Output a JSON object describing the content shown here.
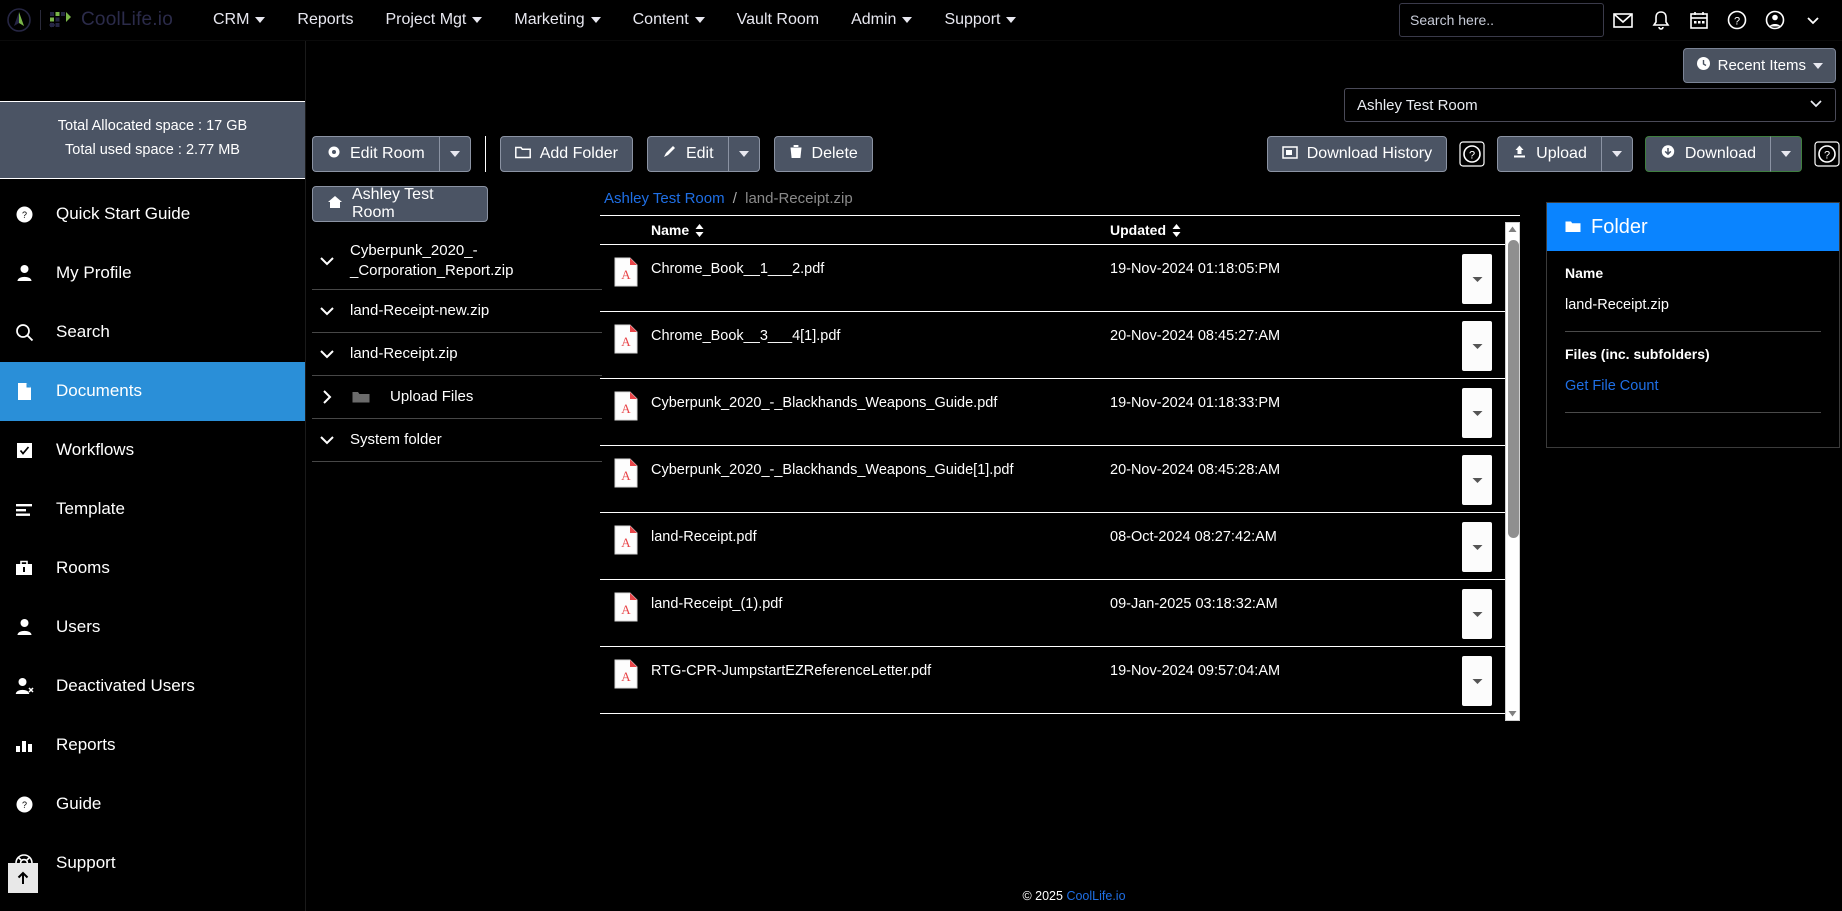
{
  "brand": {
    "name": "CoolLife.io"
  },
  "topnav": {
    "items": [
      {
        "label": "CRM",
        "has_caret": true
      },
      {
        "label": "Reports",
        "has_caret": false
      },
      {
        "label": "Project Mgt",
        "has_caret": true
      },
      {
        "label": "Marketing",
        "has_caret": true
      },
      {
        "label": "Content",
        "has_caret": true
      },
      {
        "label": "Vault Room",
        "has_caret": false
      },
      {
        "label": "Admin",
        "has_caret": true
      },
      {
        "label": "Support",
        "has_caret": true
      }
    ],
    "search_placeholder": "Search here..",
    "icons": [
      "mail-icon",
      "bell-icon",
      "calendar-icon",
      "help-circle-icon",
      "user-account-icon",
      "chevron-down-icon"
    ]
  },
  "page": {
    "title": "Vault Room",
    "recent_items_label": "Recent Items",
    "room_selected": "Ashley Test Room"
  },
  "sidebar": {
    "storage": {
      "allocated": "Total Allocated space : 17 GB",
      "used": "Total used space : 2.77 MB"
    },
    "items": [
      {
        "label": "Quick Start Guide",
        "icon": "question-circle-icon",
        "active": false
      },
      {
        "label": "My Profile",
        "icon": "user-icon",
        "active": false
      },
      {
        "label": "Search",
        "icon": "search-icon",
        "active": false
      },
      {
        "label": "Documents",
        "icon": "document-icon",
        "active": true
      },
      {
        "label": "Workflows",
        "icon": "checkbox-icon",
        "active": false
      },
      {
        "label": "Template",
        "icon": "template-icon",
        "active": false
      },
      {
        "label": "Rooms",
        "icon": "briefcase-icon",
        "active": false
      },
      {
        "label": "Users",
        "icon": "user-icon",
        "active": false
      },
      {
        "label": "Deactivated Users",
        "icon": "user-remove-icon",
        "active": false
      },
      {
        "label": "Reports",
        "icon": "bar-chart-icon",
        "active": false
      },
      {
        "label": "Guide",
        "icon": "question-circle-icon",
        "active": false
      },
      {
        "label": "Support",
        "icon": "lifebuoy-icon",
        "active": false
      }
    ]
  },
  "toolbar": {
    "edit_room": "Edit Room",
    "add_folder": "Add Folder",
    "edit": "Edit",
    "delete": "Delete",
    "download_history": "Download History",
    "upload": "Upload",
    "download": "Download"
  },
  "tree": {
    "room_label": "Ashley Test Room",
    "nodes": [
      {
        "label": "Cyberpunk_2020_-_Corporation_Report.zip",
        "state": "expanded",
        "type": "archive"
      },
      {
        "label": "land-Receipt-new.zip",
        "state": "expanded",
        "type": "archive"
      },
      {
        "label": "land-Receipt.zip",
        "state": "expanded",
        "type": "archive"
      },
      {
        "label": "Upload Files",
        "state": "collapsed",
        "type": "folder"
      },
      {
        "label": "System folder",
        "state": "expanded",
        "type": "archive"
      }
    ]
  },
  "breadcrumb": {
    "root": "Ashley Test Room",
    "separator": "/",
    "current": "land-Receipt.zip"
  },
  "table": {
    "columns": [
      "Name",
      "Updated"
    ],
    "rows": [
      {
        "name": "Chrome_Book__1___2.pdf",
        "updated": "19-Nov-2024 01:18:05:PM",
        "icon": "pdf-icon"
      },
      {
        "name": "Chrome_Book__3___4[1].pdf",
        "updated": "20-Nov-2024 08:45:27:AM",
        "icon": "pdf-icon"
      },
      {
        "name": "Cyberpunk_2020_-_Blackhands_Weapons_Guide.pdf",
        "updated": "19-Nov-2024 01:18:33:PM",
        "icon": "pdf-icon"
      },
      {
        "name": "Cyberpunk_2020_-_Blackhands_Weapons_Guide[1].pdf",
        "updated": "20-Nov-2024 08:45:28:AM",
        "icon": "pdf-icon"
      },
      {
        "name": "land-Receipt.pdf",
        "updated": "08-Oct-2024 08:27:42:AM",
        "icon": "pdf-icon"
      },
      {
        "name": "land-Receipt_(1).pdf",
        "updated": "09-Jan-2025 03:18:32:AM",
        "icon": "pdf-icon"
      },
      {
        "name": "RTG-CPR-JumpstartEZReferenceLetter.pdf",
        "updated": "19-Nov-2024 09:57:04:AM",
        "icon": "pdf-icon"
      }
    ]
  },
  "details_panel": {
    "title": "Folder",
    "name_label": "Name",
    "name_value": "land-Receipt.zip",
    "files_label": "Files (inc. subfolders)",
    "file_count_link": "Get File Count"
  },
  "footer": {
    "copyright": "© 2025",
    "link": "CoolLife.io"
  },
  "colors": {
    "accent_blue": "#0a84ff",
    "sidebar_active": "#2a8fd8",
    "button_slate": "#4b5464",
    "link_blue": "#1f6fe5",
    "pdf_red": "#e8464a",
    "download_green": "#3f7f3f"
  }
}
